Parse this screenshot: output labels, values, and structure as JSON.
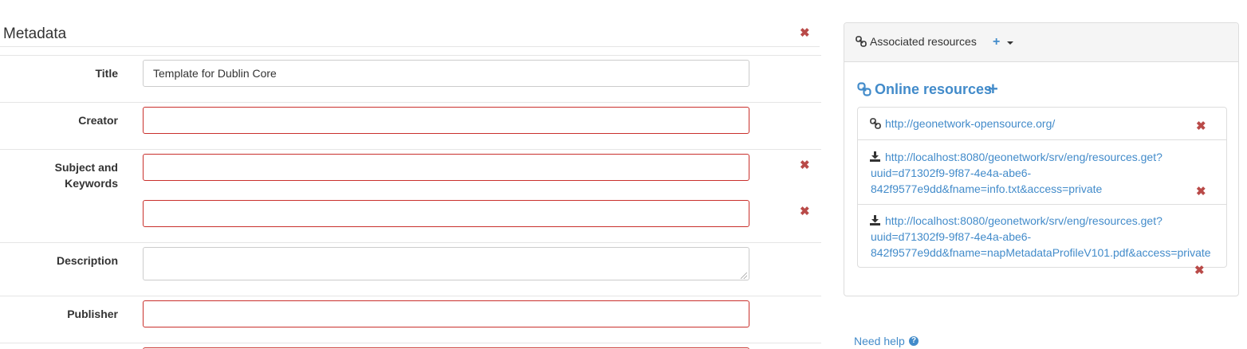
{
  "metadata_section": {
    "title": "Metadata",
    "fields": [
      {
        "label": "Title",
        "value": "Template for Dublin Core",
        "invalid": false
      },
      {
        "label": "Creator",
        "value": "",
        "invalid": true
      },
      {
        "label": "Subject and Keywords",
        "values": [
          "",
          ""
        ],
        "invalid": true
      },
      {
        "label": "Description",
        "value": "",
        "invalid": false
      },
      {
        "label": "Publisher",
        "value": "",
        "invalid": true
      }
    ]
  },
  "associated_resources": {
    "title": "Associated resources",
    "add_label": "+",
    "online_resources": {
      "heading": "Online resources",
      "add_label": "+",
      "items": [
        {
          "type": "link",
          "url": "http://geonetwork-opensource.org/"
        },
        {
          "type": "download",
          "url_lines": [
            "http://localhost:8080/geonetwork/srv/eng/resources.get?",
            "uuid=d71302f9-9f87-4e4a-abe6-",
            "842f9577e9dd&fname=info.txt&access=private"
          ]
        },
        {
          "type": "download",
          "url_lines": [
            "http://localhost:8080/geonetwork/srv/eng/resources.get?",
            "uuid=d71302f9-9f87-4e4a-abe6-",
            "842f9577e9dd&fname=napMetadataProfileV101.pdf&access=private"
          ]
        }
      ]
    }
  },
  "help": {
    "label": "Need help",
    "icon": "question-circle-icon"
  },
  "colors": {
    "accent": "#428bca",
    "invalid_border": "#c9302c",
    "remove": "#b94a48"
  }
}
